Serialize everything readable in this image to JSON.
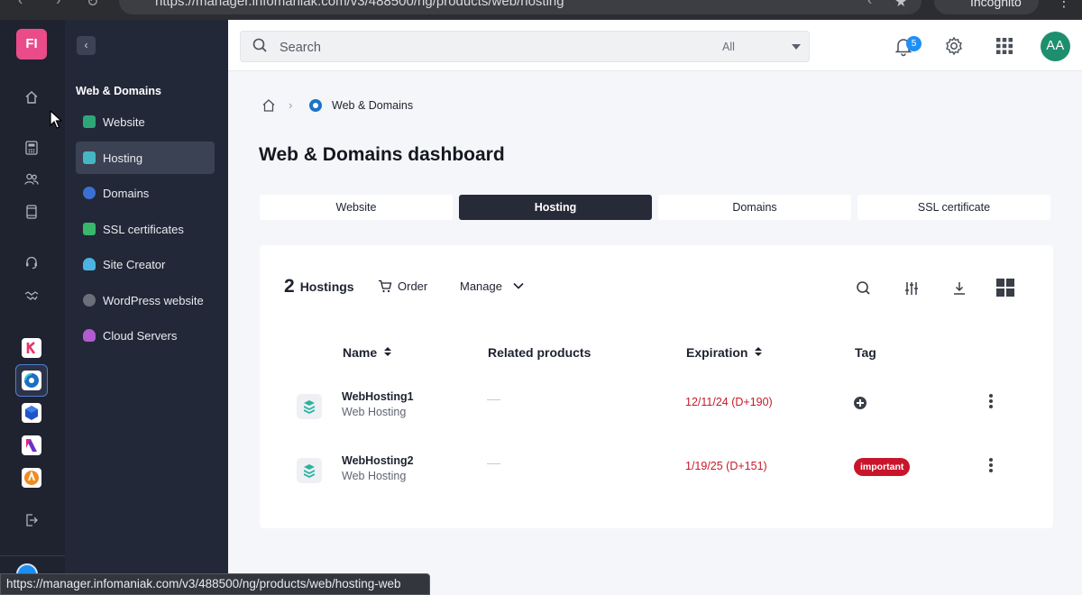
{
  "browser": {
    "url": "https://manager.infomaniak.com/v3/488500/ng/products/web/hosting",
    "incognito_label": "Incognito",
    "status_url": "https://manager.infomaniak.com/v3/488500/ng/products/web/hosting-web"
  },
  "rail": {
    "logo_initials": "FI"
  },
  "subnav": {
    "section_title": "Web & Domains",
    "items": [
      {
        "label": "Website",
        "color": "#2ea67a"
      },
      {
        "label": "Hosting",
        "color": "#45b7c4"
      },
      {
        "label": "Domains",
        "color": "#3b6fd4"
      },
      {
        "label": "SSL certificates",
        "color": "#39b86b"
      },
      {
        "label": "Site Creator",
        "color": "#4bb3e3"
      },
      {
        "label": "WordPress website",
        "color": "#6b6f7a"
      },
      {
        "label": "Cloud Servers",
        "color": "#b15ccf"
      }
    ]
  },
  "header": {
    "search_placeholder": "Search",
    "search_filter": "All",
    "notification_count": "5",
    "avatar_initials": "AA"
  },
  "breadcrumb": {
    "current": "Web & Domains"
  },
  "page": {
    "title": "Web & Domains dashboard",
    "tabs": [
      "Website",
      "Hosting",
      "Domains",
      "SSL certificate"
    ]
  },
  "hostings": {
    "count": "2",
    "count_label": "Hostings",
    "order_label": "Order",
    "manage_label": "Manage",
    "columns": {
      "name": "Name",
      "related": "Related products",
      "expiration": "Expiration",
      "tag": "Tag"
    },
    "rows": [
      {
        "name": "WebHosting1",
        "type": "Web Hosting",
        "expiration": "12/11/24 (D+190)",
        "tag": ""
      },
      {
        "name": "WebHosting2",
        "type": "Web Hosting",
        "expiration": "1/19/25 (D+151)",
        "tag": "important"
      }
    ]
  },
  "colors": {
    "accent_dark": "#272b37",
    "expiration_red": "#c41a2a",
    "tag_red": "#c8152c",
    "badge_blue": "#1f8ff6",
    "avatar_green": "#1e8f6e",
    "logo_pink": "#ea4c89"
  }
}
